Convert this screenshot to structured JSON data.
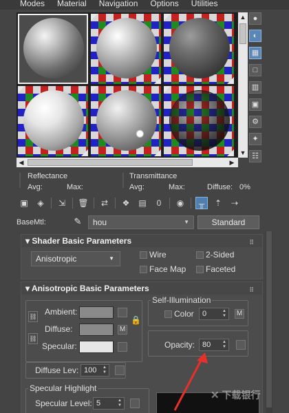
{
  "menubar": {
    "items": [
      "Modes",
      "Material",
      "Navigation",
      "Options",
      "Utilities"
    ]
  },
  "sample_slots": [
    {
      "style": "plain",
      "sphere": "matte-grey",
      "selected": true
    },
    {
      "style": "checker",
      "sphere": "light-grey",
      "selected": false
    },
    {
      "style": "checker",
      "sphere": "dark-grey",
      "selected": false
    },
    {
      "style": "checker",
      "sphere": "white",
      "selected": false
    },
    {
      "style": "checker",
      "sphere": "sparkle",
      "selected": false
    },
    {
      "style": "checker",
      "sphere": "checker-glass",
      "selected": false
    }
  ],
  "reflectance": {
    "title": "Reflectance",
    "avg_label": "Avg:",
    "max_label": "Max:"
  },
  "transmittance": {
    "title": "Transmittance",
    "avg_label": "Avg:",
    "max_label": "Max:",
    "diffuse_label": "Diffuse:",
    "diffuse_value": "0%"
  },
  "basemtl": {
    "label": "BaseMtl:",
    "name": "hou",
    "type_button": "Standard"
  },
  "shader_rollout": {
    "title": "Shader Basic Parameters",
    "shader_type": "Anisotropic",
    "wire_label": "Wire",
    "two_sided_label": "2-Sided",
    "face_map_label": "Face Map",
    "faceted_label": "Faceted"
  },
  "aniso_rollout": {
    "title": "Anisotropic Basic Parameters",
    "ambient_label": "Ambient:",
    "diffuse_label": "Diffuse:",
    "specular_label": "Specular:",
    "m_label": "M",
    "self_illum_title": "Self-Illumination",
    "color_label": "Color",
    "color_value": "0",
    "opacity_label": "Opacity:",
    "opacity_value": "80",
    "diffuse_lev_label": "Diffuse Lev:",
    "diffuse_lev_value": "100",
    "spec_highlight_title": "Specular Highlight",
    "spec_level_label": "Specular Level:",
    "spec_level_value": "5"
  },
  "colors": {
    "ambient": "#8a8a8a",
    "diffuse": "#8a8a8a",
    "specular": "#e6e6e6",
    "annotation_arrow": "#e8302a"
  },
  "watermark": {
    "text": "下载银行"
  }
}
